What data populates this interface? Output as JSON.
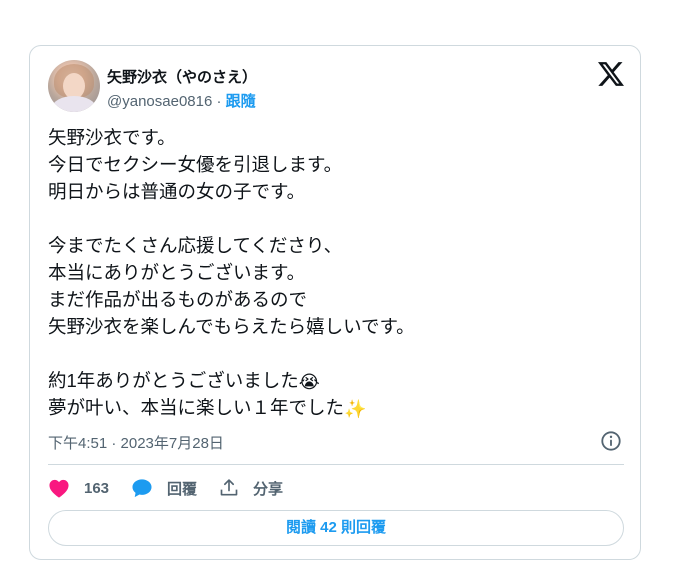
{
  "author": {
    "display_name": "矢野沙衣（やのさえ）",
    "handle": "@yanosae0816",
    "separator": "·",
    "follow_label": "跟隨"
  },
  "tweet": {
    "lines": [
      "矢野沙衣です。",
      "今日でセクシー女優を引退します。",
      "明日からは普通の女の子です。",
      "",
      "今までたくさん応援してくださり、",
      "本当にありがとうございます。",
      "まだ作品が出るものがあるので",
      "矢野沙衣を楽しんでもらえたら嬉しいです。",
      "",
      "約1年ありがとうございました",
      "夢が叶い、本当に楽しい１年でした"
    ],
    "emoji_crying": "😭",
    "emoji_sparkles": "✨",
    "timestamp": "下午4:51 · 2023年7月28日"
  },
  "actions": {
    "like_count": "163",
    "reply_label": "回覆",
    "share_label": "分享",
    "read_replies_label": "閱讀 42 則回覆"
  },
  "icons": {
    "brand": "x-logo-icon",
    "like": "heart-icon",
    "reply": "speech-bubble-icon",
    "share": "share-upload-icon",
    "info": "info-icon"
  },
  "colors": {
    "like": "#f91880",
    "reply": "#1d9bf0",
    "link": "#1d9bf0",
    "muted": "#536471",
    "border": "#cfd9de"
  }
}
